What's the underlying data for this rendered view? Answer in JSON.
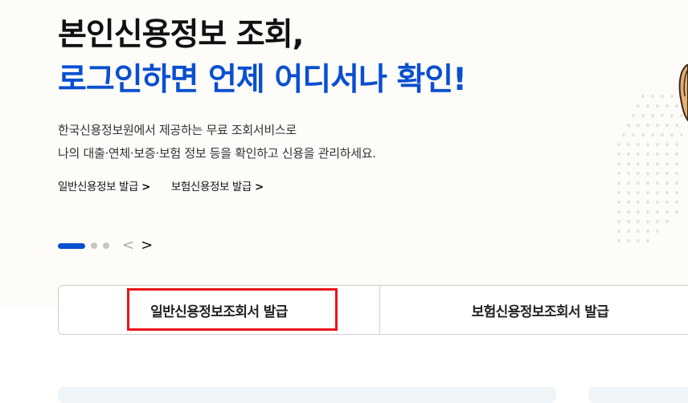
{
  "hero": {
    "headline_line1": "본인신용정보 조회,",
    "headline_line2": "로그인하면 언제 어디서나 확인!",
    "desc_line1": "한국신용정보원에서 제공하는 무료 조회서비스로",
    "desc_line2": "나의 대출·연체·보증·보험 정보 등을 확인하고 신용을 관리하세요.",
    "link1": "일반신용정보 발급",
    "link2": "보험신용정보 발급",
    "link_chevron": ">"
  },
  "pager": {
    "prev_icon": "chevron-left-icon",
    "next_icon": "chevron-right-icon",
    "prev_glyph": "<",
    "next_glyph": ">"
  },
  "tabs": [
    {
      "label": "일반신용정보조회서 발급"
    },
    {
      "label": "보험신용정보조회서 발급"
    }
  ],
  "colors": {
    "accent": "#0a4fd0",
    "highlight_border": "#e8141a",
    "hero_bg": "#fdfcf8"
  }
}
